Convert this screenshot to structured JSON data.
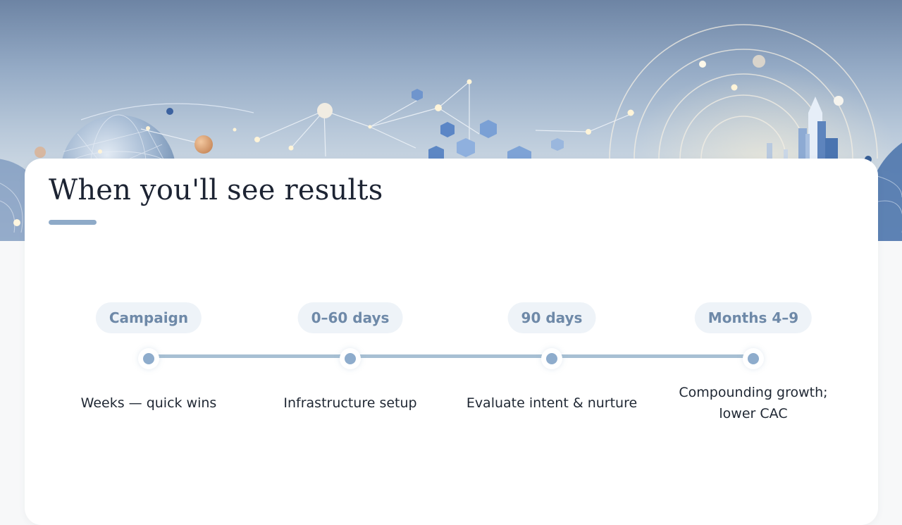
{
  "slide": {
    "title": "When you'll see results"
  },
  "timeline": {
    "milestones": [
      {
        "label": "Campaign",
        "description": "Weeks — quick wins"
      },
      {
        "label": "0–60 days",
        "description": "Infrastructure setup"
      },
      {
        "label": "90 days",
        "description": "Evaluate intent & nurture"
      },
      {
        "label": "Months 4–9",
        "description": "Compounding growth; lower CAC"
      }
    ]
  },
  "colors": {
    "accent": "#8eaac8",
    "pill_background": "#eef3f8",
    "pill_text": "#6e89a8",
    "line": "#a7bfd3",
    "title_text": "#1d2433"
  }
}
